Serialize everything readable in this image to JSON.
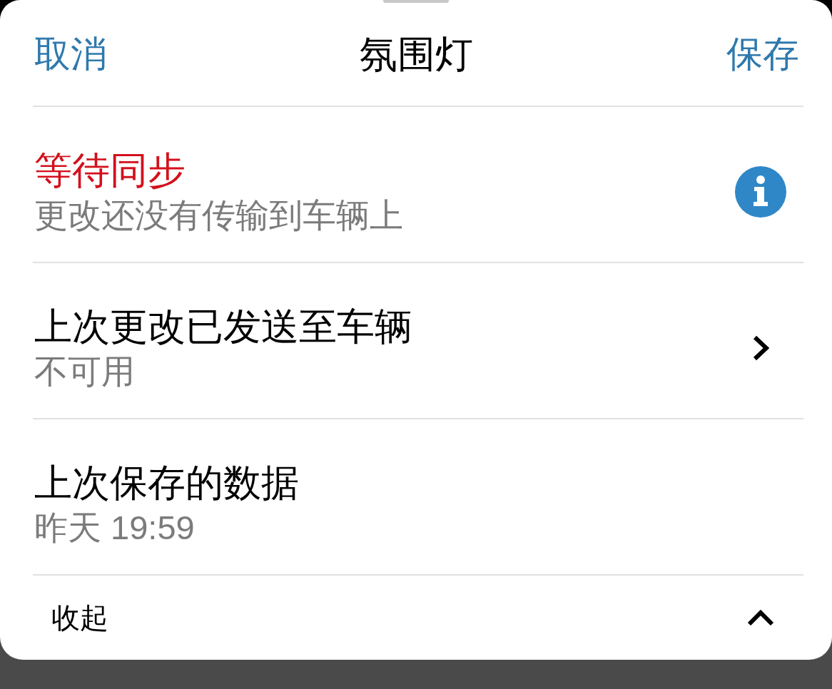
{
  "header": {
    "cancel": "取消",
    "title": "氛围灯",
    "save": "保存"
  },
  "items": [
    {
      "kind": "warning",
      "title": "等待同步",
      "subtitle": "更改还没有传输到车辆上"
    },
    {
      "kind": "link",
      "title": "上次更改已发送至车辆",
      "subtitle": "不可用"
    },
    {
      "kind": "plain",
      "title": "上次保存的数据",
      "subtitle": "昨天 19:59"
    }
  ],
  "footer": {
    "label": "收起",
    "expanded": true
  }
}
